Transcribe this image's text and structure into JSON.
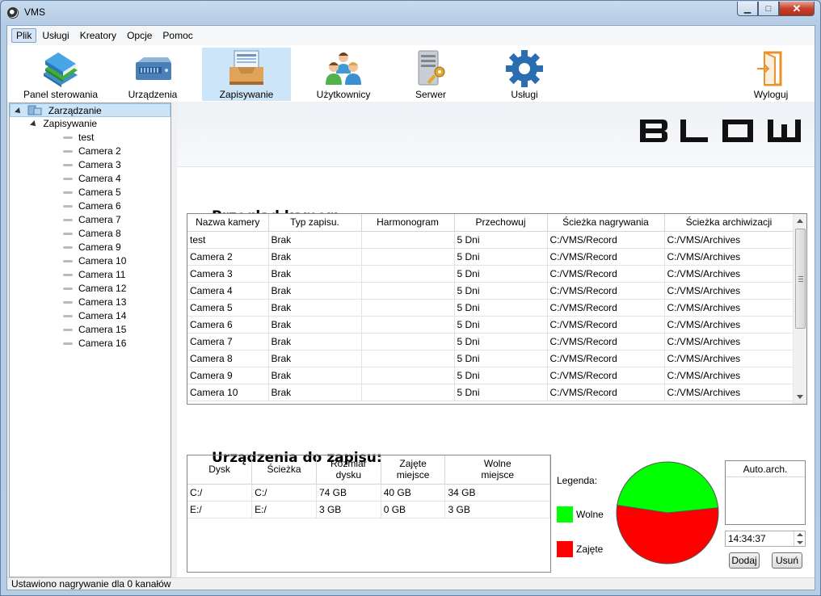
{
  "window": {
    "title": "VMS",
    "minimize": "▁",
    "maximize": "□",
    "close": "✕"
  },
  "menubar": [
    "Plik",
    "Usługi",
    "Kreatory",
    "Opcje",
    "Pomoc"
  ],
  "toolbar": {
    "items": [
      {
        "label": "Panel sterowania",
        "icon": "books-icon"
      },
      {
        "label": "Urządzenia",
        "icon": "nvr-device-icon"
      },
      {
        "label": "Zapisywanie",
        "icon": "archive-tray-icon"
      },
      {
        "label": "Użytkownicy",
        "icon": "users-group-icon"
      },
      {
        "label": "Serwer",
        "icon": "server-key-icon"
      },
      {
        "label": "Usługi",
        "icon": "gear-icon"
      }
    ],
    "logout_label": "Wyloguj",
    "active": "Zapisywanie"
  },
  "tree": {
    "root": "Zarządzanie",
    "child": "Zapisywanie",
    "items": [
      "test",
      "Camera 2",
      "Camera 3",
      "Camera 4",
      "Camera 5",
      "Camera 6",
      "Camera 7",
      "Camera 8",
      "Camera 9",
      "Camera 10",
      "Camera 11",
      "Camera 12",
      "Camera 13",
      "Camera 14",
      "Camera 15",
      "Camera 16"
    ]
  },
  "brand": {
    "logo_text": "BLOW"
  },
  "cameras": {
    "title": "Przegląd kamer:",
    "columns": [
      "Nazwa kamery",
      "Typ zapisu.",
      "Harmonogram",
      "Przechowuj",
      "Ścieżka nagrywania",
      "Ścieżka archiwizacji"
    ],
    "rows": [
      [
        "test",
        "Brak",
        "",
        "5 Dni",
        "C:/VMS/Record",
        "C:/VMS/Archives"
      ],
      [
        "Camera 2",
        "Brak",
        "",
        "5 Dni",
        "C:/VMS/Record",
        "C:/VMS/Archives"
      ],
      [
        "Camera 3",
        "Brak",
        "",
        "5 Dni",
        "C:/VMS/Record",
        "C:/VMS/Archives"
      ],
      [
        "Camera 4",
        "Brak",
        "",
        "5 Dni",
        "C:/VMS/Record",
        "C:/VMS/Archives"
      ],
      [
        "Camera 5",
        "Brak",
        "",
        "5 Dni",
        "C:/VMS/Record",
        "C:/VMS/Archives"
      ],
      [
        "Camera 6",
        "Brak",
        "",
        "5 Dni",
        "C:/VMS/Record",
        "C:/VMS/Archives"
      ],
      [
        "Camera 7",
        "Brak",
        "",
        "5 Dni",
        "C:/VMS/Record",
        "C:/VMS/Archives"
      ],
      [
        "Camera 8",
        "Brak",
        "",
        "5 Dni",
        "C:/VMS/Record",
        "C:/VMS/Archives"
      ],
      [
        "Camera 9",
        "Brak",
        "",
        "5 Dni",
        "C:/VMS/Record",
        "C:/VMS/Archives"
      ],
      [
        "Camera 10",
        "Brak",
        "",
        "5 Dni",
        "C:/VMS/Record",
        "C:/VMS/Archives"
      ]
    ]
  },
  "devices": {
    "title": "Urządzenia do zapisu:",
    "columns": [
      [
        "Dysk"
      ],
      [
        "Ścieżka"
      ],
      [
        "Rozmiar",
        "dysku"
      ],
      [
        "Zajęte",
        "miejsce"
      ],
      [
        "Wolne",
        "miejsce"
      ]
    ],
    "rows": [
      [
        "C:/",
        "C:/",
        "74 GB",
        "40 GB",
        "34 GB"
      ],
      [
        "E:/",
        "E:/",
        "3 GB",
        "0 GB",
        "3 GB"
      ]
    ]
  },
  "legend": {
    "title": "Legenda:",
    "free_label": "Wolne",
    "used_label": "Zajęte",
    "free_color": "#00ff00",
    "used_color": "#ff0000"
  },
  "usage": {
    "used_fraction": 0.54,
    "free_fraction": 0.46
  },
  "archive": {
    "header": "Auto.arch.",
    "time": "14:34:37",
    "add_label": "Dodaj",
    "remove_label": "Usuń"
  },
  "status": "Ustawiono nagrywanie dla 0 kanałów"
}
